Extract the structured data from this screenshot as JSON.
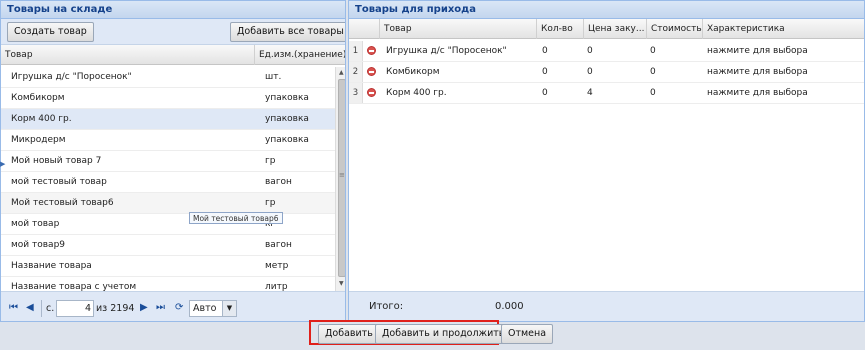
{
  "left_panel": {
    "title": "Товары на складе",
    "create_button": "Создать товар",
    "add_all_button": "Добавить все товары",
    "columns": [
      "Товар",
      "Ед.изм.(хранение)"
    ],
    "rows": [
      {
        "name": "Игрушка д/с \"Поросенок\"",
        "unit": "шт."
      },
      {
        "name": "Комбикорм",
        "unit": "упаковка"
      },
      {
        "name": "Корм 400 гр.",
        "unit": "упаковка"
      },
      {
        "name": "Микродерм",
        "unit": "упаковка"
      },
      {
        "name": "Мой новый товар 7",
        "unit": "гр"
      },
      {
        "name": "мой тестовый товар",
        "unit": "вагон"
      },
      {
        "name": "Мой тестовый товар6",
        "unit": "гр"
      },
      {
        "name": "мой товар",
        "unit": "кг"
      },
      {
        "name": "мой товар9",
        "unit": "вагон"
      },
      {
        "name": "Название товара",
        "unit": "метр"
      },
      {
        "name": "Название товара с учетом",
        "unit": "литр"
      }
    ],
    "tooltip": "Мой тестовый товар6"
  },
  "pager": {
    "page_label": "с.",
    "page_value": "4",
    "of_label": "из 2194",
    "page_size": "Авто"
  },
  "right_panel": {
    "title": "Товары для прихода",
    "columns": [
      "Товар",
      "Кол-во",
      "Цена заку...",
      "Стоимость",
      "Характеристика"
    ],
    "rows": [
      {
        "num": "1",
        "name": "Игрушка д/с \"Поросенок\"",
        "qty": "0",
        "price": "0",
        "cost": "0",
        "char": "нажмите для выбора"
      },
      {
        "num": "2",
        "name": "Комбикорм",
        "qty": "0",
        "price": "0",
        "cost": "0",
        "char": "нажмите для выбора"
      },
      {
        "num": "3",
        "name": "Корм 400 гр.",
        "qty": "0",
        "price": "4",
        "cost": "0",
        "char": "нажмите для выбора"
      }
    ],
    "total_label": "Итого:",
    "total_value": "0.000"
  },
  "footer": {
    "add_button": "Добавить",
    "add_continue_button": "Добавить и продолжить",
    "cancel_button": "Отмена",
    "highlight_color": "#e0201a"
  }
}
